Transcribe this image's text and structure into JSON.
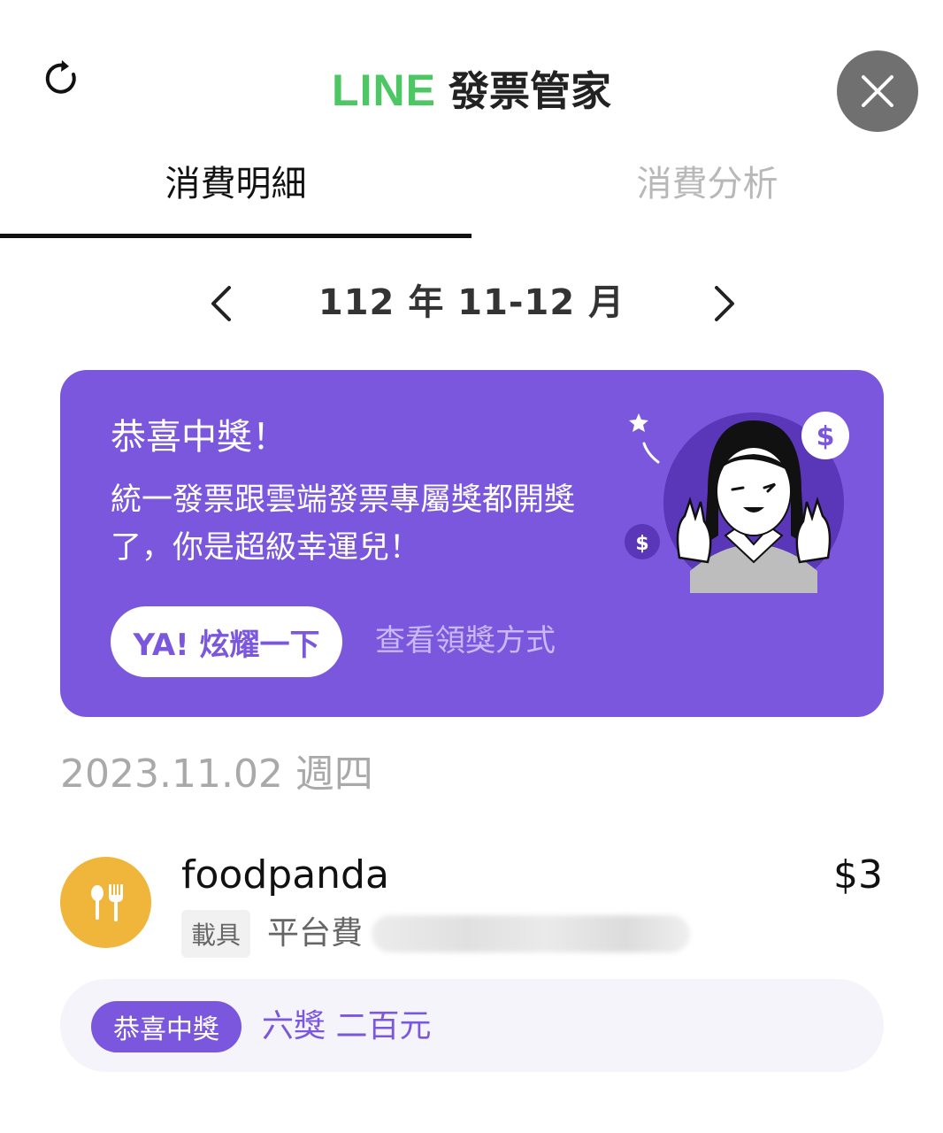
{
  "header": {
    "brand": "LINE",
    "title": "發票管家"
  },
  "tabs": [
    {
      "label": "消費明細",
      "active": true
    },
    {
      "label": "消費分析",
      "active": false
    }
  ],
  "month_nav": {
    "label": "112 年 11-12 月"
  },
  "banner": {
    "title": "恭喜中獎！",
    "description": "統一發票跟雲端發票專屬獎都開獎了，你是超級幸運兒！",
    "primary_button": "YA! 炫耀一下",
    "secondary_link": "查看領獎方式",
    "coin_symbol": "$"
  },
  "date_heading": "2023.11.02 週四",
  "transaction": {
    "merchant": "foodpanda",
    "amount": "$3",
    "carrier_tag": "載具",
    "description": "平台費",
    "icon": "utensils-icon"
  },
  "prize": {
    "badge": "恭喜中獎",
    "text": "六獎 二百元"
  },
  "colors": {
    "line_green": "#4cc764",
    "purple": "#7b57dd",
    "food_orange": "#f0b63b"
  }
}
